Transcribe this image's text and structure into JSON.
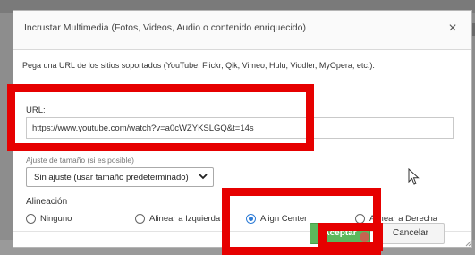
{
  "dialog": {
    "title": "Incrustar Multimedia (Fotos, Videos, Audio o contenido enriquecido)",
    "close_glyph": "×",
    "description": "Pega una URL de los sitios soportados (YouTube, Flickr, Qik, Vimeo, Hulu, Viddler, MyOpera, etc.).",
    "url": {
      "label": "URL:",
      "value": "https://www.youtube.com/watch?v=a0cWZYKSLGQ&t=14s"
    },
    "size": {
      "label": "Ajuste de tamaño (si es posible)",
      "selected": "Sin ajuste (usar tamaño predeterminado)"
    },
    "alignment": {
      "label": "Alineación",
      "options": [
        {
          "label": "Ninguno",
          "checked": false
        },
        {
          "label": "Alinear a Izquierda",
          "checked": false
        },
        {
          "label": "Align Center",
          "checked": true
        },
        {
          "label": "Alinear a Derecha",
          "checked": false
        }
      ]
    },
    "buttons": {
      "accept": "Aceptar",
      "cancel": "Cancelar"
    }
  },
  "annotations": {
    "highlight_color": "#e60000",
    "accent_color": "#2e7cd6",
    "accept_color": "#5cb85c",
    "icons": [
      "close-icon",
      "chevron-down-icon",
      "mouse-pointer-icon",
      "resize-grip-icon"
    ]
  }
}
